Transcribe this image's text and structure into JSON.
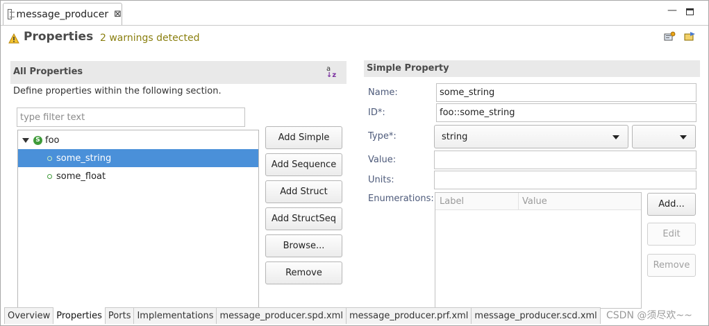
{
  "window": {
    "tab_title": "message_producer",
    "close_glyph": "⊠",
    "minimize_glyph": "—"
  },
  "header": {
    "title": "Properties",
    "warning_text": "2 warnings detected",
    "warning_icon": "warning-triangle-icon"
  },
  "all_properties": {
    "title": "All Properties",
    "description": "Define properties within the following section.",
    "filter_placeholder": "type filter text",
    "sort_icon": "sort-alpha-icon",
    "tree": [
      {
        "label": "foo",
        "kind": "struct",
        "expanded": true
      },
      {
        "label": "some_string",
        "kind": "simple",
        "selected": true
      },
      {
        "label": "some_float",
        "kind": "simple",
        "selected": false
      }
    ],
    "buttons": [
      "Add Simple",
      "Add Sequence",
      "Add Struct",
      "Add StructSeq",
      "Browse...",
      "Remove"
    ]
  },
  "simple_property": {
    "title": "Simple Property",
    "name_label": "Name:",
    "name_value": "some_string",
    "id_label": "ID*:",
    "id_value": "foo::some_string",
    "type_label": "Type*:",
    "type_value": "string",
    "type_secondary_value": "",
    "value_label": "Value:",
    "value_value": "",
    "units_label": "Units:",
    "units_value": "",
    "enumerations_label": "Enumerations:",
    "enum_columns": [
      "Label",
      "Value"
    ],
    "add_button": "Add...",
    "edit_button": "Edit",
    "remove_button": "Remove"
  },
  "page_tabs": [
    {
      "label": "Overview",
      "active": false
    },
    {
      "label": "Properties",
      "active": true
    },
    {
      "label": "Ports",
      "active": false
    },
    {
      "label": "Implementations",
      "active": false
    },
    {
      "label": "message_producer.spd.xml",
      "active": false
    },
    {
      "label": "message_producer.prf.xml",
      "active": false
    },
    {
      "label": "message_producer.scd.xml",
      "active": false
    }
  ],
  "watermark": "CSDN @须尽欢~~",
  "colors": {
    "selection": "#4a90d9",
    "warning_text": "#8a7f0f",
    "struct_icon": "#3f9b3a",
    "label_text": "#4d5a7a"
  }
}
